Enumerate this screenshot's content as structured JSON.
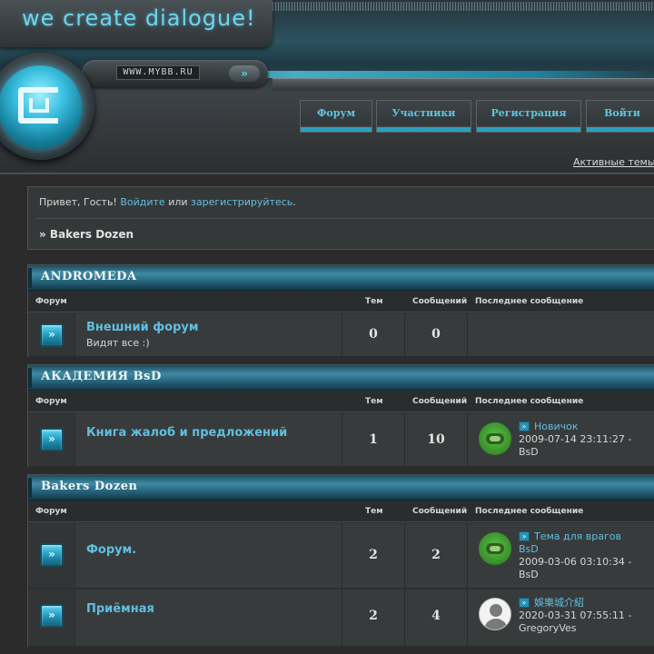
{
  "header": {
    "logo_text": "we create dialogue!",
    "url_text": "WWW.MYBB.RU",
    "go_glyph": "»",
    "nav": [
      {
        "label": "Форум"
      },
      {
        "label": "Участники"
      },
      {
        "label": "Регистрация"
      },
      {
        "label": "Войти"
      }
    ],
    "active_topics": "Активные темы"
  },
  "welcome": {
    "greeting": "Привет, Гость!",
    "login": "Войдите",
    "or": "или",
    "register": "зарегистрируйтесь",
    "period": ".",
    "breadcrumb": "» Bakers Dozen"
  },
  "columns": {
    "forum": "Форум",
    "topics": "Тем",
    "posts": "Сообщений",
    "last": "Последнее сообщение"
  },
  "categories": [
    {
      "title": "ANDROMEDA",
      "forums": [
        {
          "title": "Внешний форум",
          "desc": "Видят все :)",
          "topics": "0",
          "posts": "0"
        }
      ]
    },
    {
      "title": "АКАДЕМИЯ BsD",
      "forums": [
        {
          "title": "Книга жалоб и предложений",
          "topics": "1",
          "posts": "10",
          "last_title": "Новичок",
          "last_date": "2009-07-14 23:11:27 -",
          "last_user": "BsD"
        }
      ]
    },
    {
      "title": "Bakers Dozen",
      "forums": [
        {
          "title": "Форум.",
          "topics": "2",
          "posts": "2",
          "last_title": "Тема для врагов",
          "last_title2": "BsD",
          "last_date": "2009-03-06 03:10:34 -",
          "last_user": "BsD"
        },
        {
          "title": "Приёмная",
          "topics": "2",
          "posts": "4",
          "last_title": "娛樂城介紹",
          "last_date": "2020-03-31 07:55:11 -",
          "last_user": "GregoryVes"
        }
      ]
    }
  ],
  "colors": {
    "accent": "#5fbfe0",
    "nav_text": "#5cc7e4",
    "bar": "#2b9fbd"
  }
}
